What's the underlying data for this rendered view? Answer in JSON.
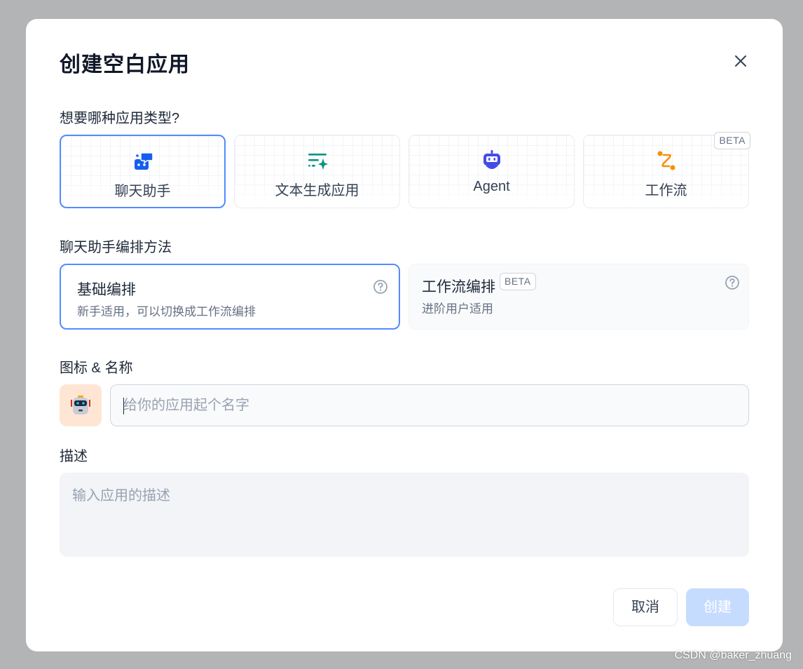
{
  "modal": {
    "title": "创建空白应用",
    "app_type_label": "想要哪种应用类型?",
    "app_types": [
      {
        "label": "聊天助手",
        "icon": "chat-bot-icon",
        "color": "#155eef",
        "selected": true
      },
      {
        "label": "文本生成应用",
        "icon": "text-generation-icon",
        "color": "#0e9384",
        "selected": false
      },
      {
        "label": "Agent",
        "icon": "agent-robot-icon",
        "color": "#444ce7",
        "selected": false
      },
      {
        "label": "工作流",
        "icon": "workflow-icon",
        "color": "#f79009",
        "selected": false,
        "badge": "BETA"
      }
    ],
    "mode_label": "聊天助手编排方法",
    "modes": [
      {
        "title": "基础编排",
        "desc": "新手适用，可以切换成工作流编排",
        "selected": true
      },
      {
        "title": "工作流编排",
        "desc": "进阶用户适用",
        "badge": "BETA",
        "selected": false
      }
    ],
    "icon_name_label": "图标 & 名称",
    "name_input": {
      "placeholder": "给你的应用起个名字",
      "value": ""
    },
    "avatar": {
      "icon": "robot-face-icon",
      "background": "#ffe6d4"
    },
    "desc_label": "描述",
    "desc_input": {
      "placeholder": "输入应用的描述",
      "value": ""
    },
    "buttons": {
      "cancel": "取消",
      "create": "创建"
    },
    "accent": "#528bff"
  },
  "watermark": "CSDN @baker_zhuang"
}
